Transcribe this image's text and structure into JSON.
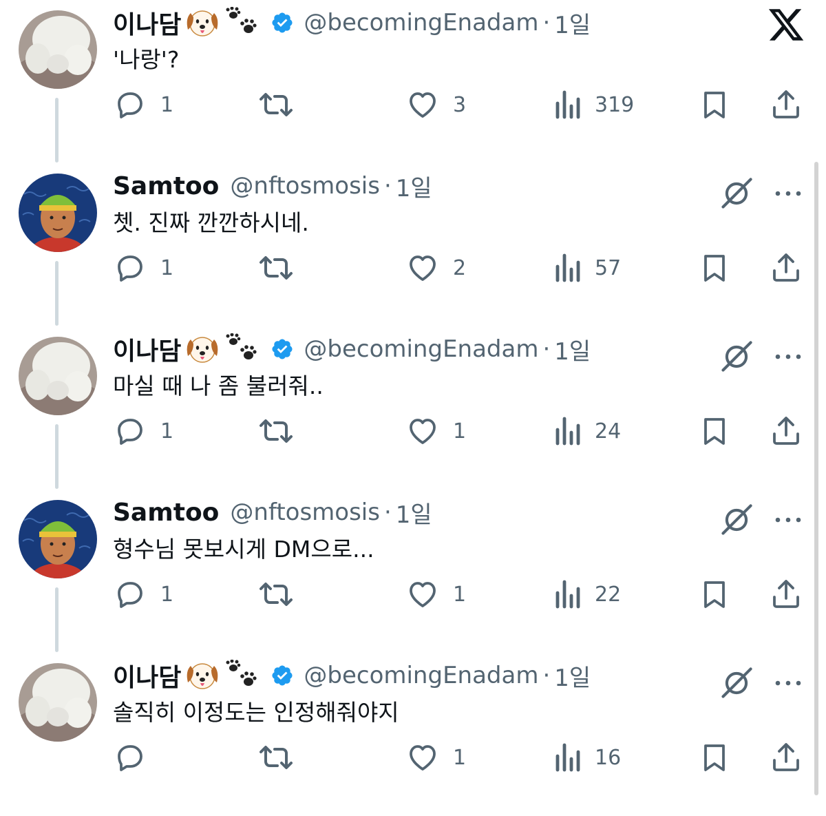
{
  "tweets": [
    {
      "id": "t1",
      "author": {
        "name": "이나담",
        "handle": "@becomingEnadam",
        "verified": true,
        "avatar": "white-plush-avatar",
        "emojis": [
          "dog-face-icon",
          "paw-prints-icon"
        ]
      },
      "time": "1일",
      "text": "'나랑'?",
      "stats": {
        "replies": "1",
        "reposts": "",
        "likes": "3",
        "views": "319"
      },
      "top_right": "x-logo-icon"
    },
    {
      "id": "t2",
      "author": {
        "name": "Samtoo",
        "handle": "@nftosmosis",
        "verified": false,
        "avatar": "green-cap-cartoon-avatar"
      },
      "time": "1일",
      "text": "쳇. 진짜 깐깐하시네.",
      "stats": {
        "replies": "1",
        "reposts": "",
        "likes": "2",
        "views": "57"
      },
      "top_right": "grok-icon"
    },
    {
      "id": "t3",
      "author": {
        "name": "이나담",
        "handle": "@becomingEnadam",
        "verified": true,
        "avatar": "white-plush-avatar",
        "emojis": [
          "dog-face-icon",
          "paw-prints-icon"
        ]
      },
      "time": "1일",
      "text": "마실 때 나 좀 불러줘..",
      "stats": {
        "replies": "1",
        "reposts": "",
        "likes": "1",
        "views": "24"
      },
      "top_right": "grok-icon"
    },
    {
      "id": "t4",
      "author": {
        "name": "Samtoo",
        "handle": "@nftosmosis",
        "verified": false,
        "avatar": "green-cap-cartoon-avatar"
      },
      "time": "1일",
      "text": "형수님 못보시게 DM으로...",
      "stats": {
        "replies": "1",
        "reposts": "",
        "likes": "1",
        "views": "22"
      },
      "top_right": "grok-icon"
    },
    {
      "id": "t5",
      "author": {
        "name": "이나담",
        "handle": "@becomingEnadam",
        "verified": true,
        "avatar": "white-plush-avatar",
        "emojis": [
          "dog-face-icon",
          "paw-prints-icon"
        ]
      },
      "time": "1일",
      "text": "솔직히 이정도는 인정해줘야지",
      "stats": {
        "replies": "",
        "reposts": "",
        "likes": "1",
        "views": "16"
      },
      "top_right": "grok-icon"
    }
  ],
  "separator": "·",
  "colors": {
    "text": "#0f1419",
    "secondary": "#536471",
    "verified": "#1d9bf0",
    "thread_line": "#cfd9de"
  }
}
